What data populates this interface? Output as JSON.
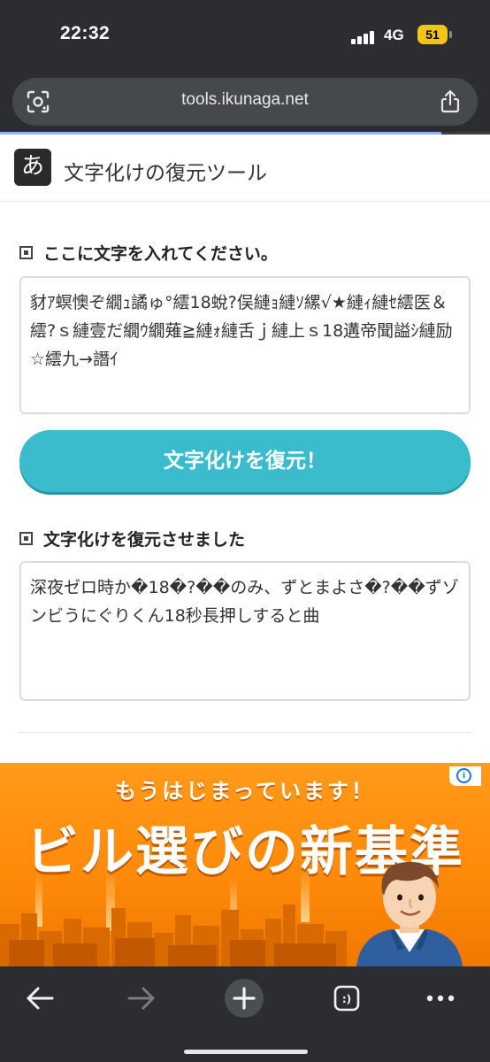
{
  "status_bar": {
    "time": "22:32",
    "network": "4G",
    "battery": "51"
  },
  "browser": {
    "url": "tools.ikunaga.net",
    "lens_icon": "lens-icon",
    "share_icon": "share-icon",
    "progress": 0.9
  },
  "site": {
    "logo_char": "あ",
    "title": "文字化けの復元ツール"
  },
  "input_section": {
    "heading": "ここに文字を入れてください。",
    "value": "豺ｱ螟懊ぞ繝ｭ譎ゅ°繧18蛻?俣縺ｮ縺ｿ縲√★縺ｨ縺ｾ繧医＆繧?ｓ縺壹だ繝ｳ繝薙≧縺ｫ縺舌ｊ縺上ｓ18遘帝聞謚ｼ縺励☆繧九→譖ｲ"
  },
  "restore_button": {
    "label": "文字化けを復元！"
  },
  "output_section": {
    "heading": "文字化けを復元させました",
    "value": "深夜ゼロ時か�18�?��のみ、ずとまよさ�?��ずゾンビうにぐりくん18秒長押しすると曲"
  },
  "ad": {
    "tagline": "もうはじまっています！",
    "headline": "ビル選びの新基準",
    "info_glyph": "i",
    "colors": {
      "background": "#ff8a0a",
      "text": "#ffffff"
    }
  },
  "toolbar": {
    "back_icon": "back-arrow-icon",
    "forward_icon": "forward-arrow-icon",
    "new_tab_icon": "plus-icon",
    "tabs_icon": "tab-switcher-icon",
    "tabs_glyph": ":)",
    "menu_icon": "more-dots-icon"
  },
  "colors": {
    "accent": "#3bbccd",
    "chrome": "#2b2d30"
  }
}
